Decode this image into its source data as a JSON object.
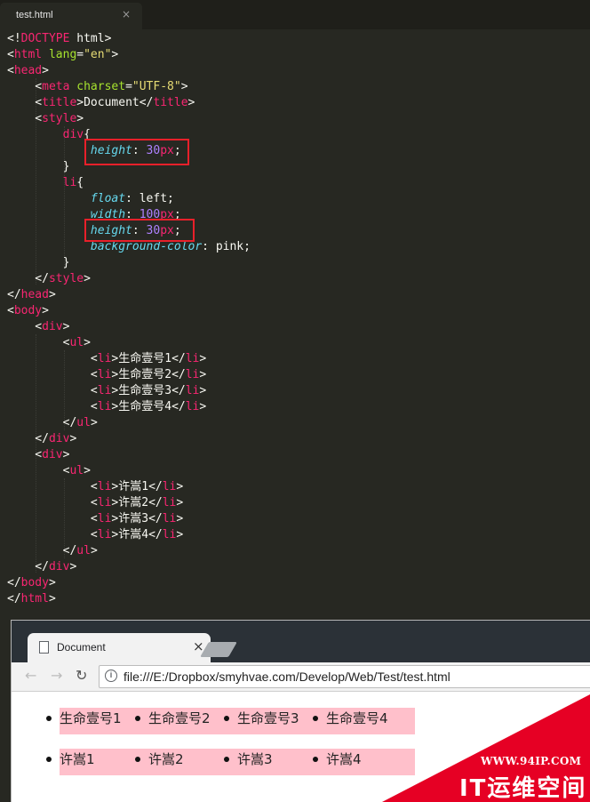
{
  "editor": {
    "tab_title": "test.html",
    "tab_close": "×",
    "code": {
      "doctype": "DOCTYPE",
      "html": "html",
      "lang_attr": "lang",
      "lang_value": "\"en\"",
      "head": "head",
      "meta": "meta",
      "charset_attr": "charset",
      "charset_value": "\"UTF-8\"",
      "title": "title",
      "document_text": "Document",
      "style": "style",
      "div_selector": "div",
      "li_selector": "li",
      "prop_height": "height",
      "prop_float": "float",
      "prop_width": "width",
      "prop_bg": "background-color",
      "val_30": "30",
      "val_100": "100",
      "unit_px": "px",
      "val_left": "left",
      "val_pink": "pink",
      "body": "body",
      "div": "div",
      "ul": "ul",
      "li": "li",
      "items_group1": [
        "生命壹号1",
        "生命壹号2",
        "生命壹号3",
        "生命壹号4"
      ],
      "items_group2": [
        "许嵩1",
        "许嵩2",
        "许嵩3",
        "许嵩4"
      ]
    }
  },
  "browser": {
    "tab_title": "Document",
    "tab_close": "×",
    "back_icon": "←",
    "forward_icon": "→",
    "reload_icon": "↻",
    "info_icon": "i",
    "url": "file:///E:/Dropbox/smyhvae.com/Develop/Web/Test/test.html",
    "list1": [
      "生命壹号1",
      "生命壹号2",
      "生命壹号3",
      "生命壹号4"
    ],
    "list2": [
      "许嵩1",
      "许嵩2",
      "许嵩3",
      "许嵩4"
    ],
    "li_color": "#ffc0cb"
  },
  "watermark": {
    "site": "WWW.94IP.COM",
    "brand": "IT运维空间"
  }
}
